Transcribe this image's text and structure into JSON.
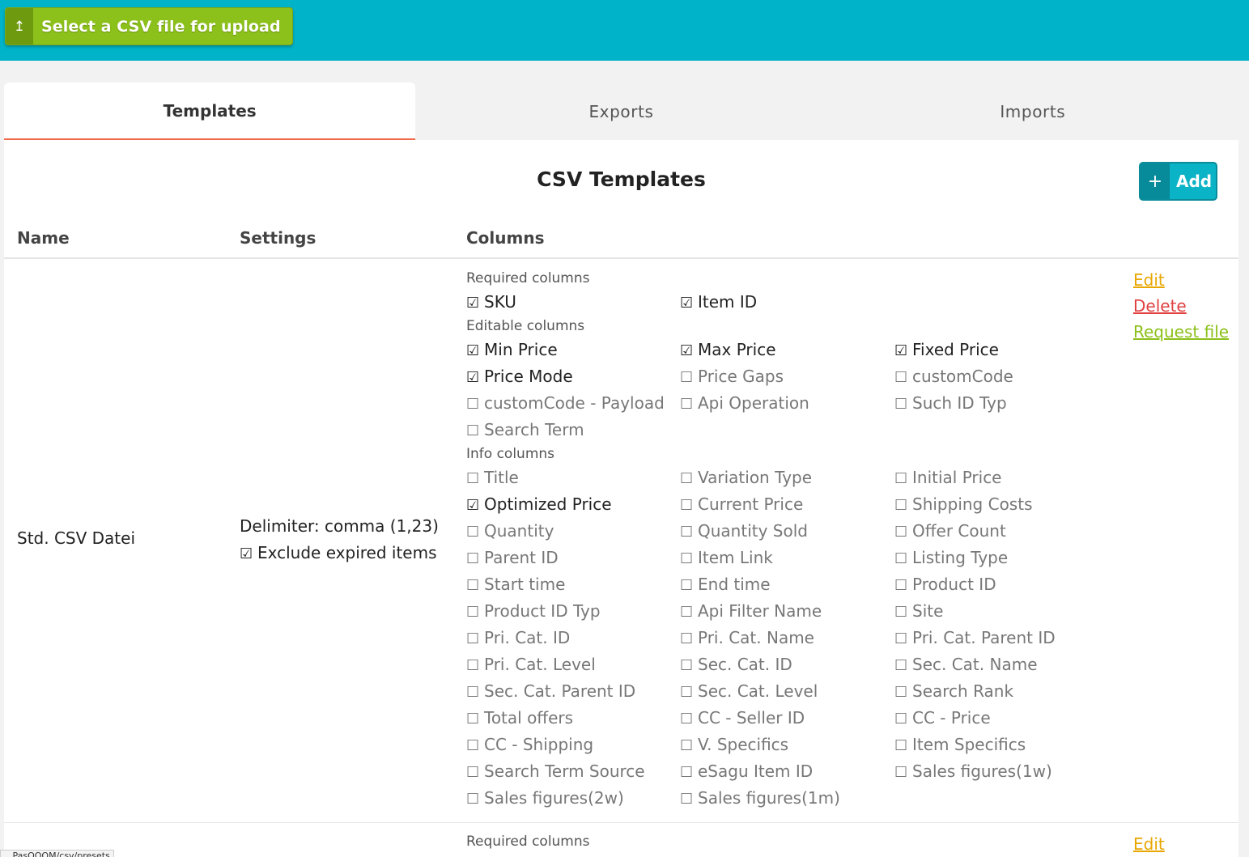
{
  "toolbar": {
    "upload_label": "Select a CSV file for upload"
  },
  "tabs": [
    {
      "label": "Templates",
      "active": true
    },
    {
      "label": "Exports",
      "active": false
    },
    {
      "label": "Imports",
      "active": false
    }
  ],
  "panel": {
    "title": "CSV Templates",
    "add_label": "Add"
  },
  "table": {
    "headers": {
      "name": "Name",
      "settings": "Settings",
      "columns": "Columns"
    },
    "group_labels": {
      "required": "Required columns",
      "editable": "Editable columns",
      "info": "Info columns"
    },
    "rows": [
      {
        "name": "Std. CSV Datei",
        "delimiter": "Delimiter: comma (1,23)",
        "exclude_expired": "Exclude expired items",
        "actions": {
          "edit": "Edit",
          "delete": "Delete",
          "request": "Request file"
        },
        "required": [
          {
            "label": "SKU",
            "checked": true
          },
          {
            "label": "Item ID",
            "checked": true
          }
        ],
        "editable": [
          {
            "label": "Min Price",
            "checked": true
          },
          {
            "label": "Max Price",
            "checked": true
          },
          {
            "label": "Fixed Price",
            "checked": true
          },
          {
            "label": "Price Mode",
            "checked": true
          },
          {
            "label": "Price Gaps",
            "checked": false
          },
          {
            "label": "customCode",
            "checked": false
          },
          {
            "label": "customCode - Payload",
            "checked": false
          },
          {
            "label": "Api Operation",
            "checked": false
          },
          {
            "label": "Such ID Typ",
            "checked": false
          },
          {
            "label": "Search Term",
            "checked": false
          }
        ],
        "info": [
          {
            "label": "Title",
            "checked": false
          },
          {
            "label": "Variation Type",
            "checked": false
          },
          {
            "label": "Initial Price",
            "checked": false
          },
          {
            "label": "Optimized Price",
            "checked": true
          },
          {
            "label": "Current Price",
            "checked": false
          },
          {
            "label": "Shipping Costs",
            "checked": false
          },
          {
            "label": "Quantity",
            "checked": false
          },
          {
            "label": "Quantity Sold",
            "checked": false
          },
          {
            "label": "Offer Count",
            "checked": false
          },
          {
            "label": "Parent ID",
            "checked": false
          },
          {
            "label": "Item Link",
            "checked": false
          },
          {
            "label": "Listing Type",
            "checked": false
          },
          {
            "label": "Start time",
            "checked": false
          },
          {
            "label": "End time",
            "checked": false
          },
          {
            "label": "Product ID",
            "checked": false
          },
          {
            "label": "Product ID Typ",
            "checked": false
          },
          {
            "label": "Api Filter Name",
            "checked": false
          },
          {
            "label": "Site",
            "checked": false
          },
          {
            "label": "Pri. Cat. ID",
            "checked": false
          },
          {
            "label": "Pri. Cat. Name",
            "checked": false
          },
          {
            "label": "Pri. Cat. Parent ID",
            "checked": false
          },
          {
            "label": "Pri. Cat. Level",
            "checked": false
          },
          {
            "label": "Sec. Cat. ID",
            "checked": false
          },
          {
            "label": "Sec. Cat. Name",
            "checked": false
          },
          {
            "label": "Sec. Cat. Parent ID",
            "checked": false
          },
          {
            "label": "Sec. Cat. Level",
            "checked": false
          },
          {
            "label": "Search Rank",
            "checked": false
          },
          {
            "label": "Total offers",
            "checked": false
          },
          {
            "label": "CC - Seller ID",
            "checked": false
          },
          {
            "label": "CC - Price",
            "checked": false
          },
          {
            "label": "CC - Shipping",
            "checked": false
          },
          {
            "label": "V. Specifics",
            "checked": false
          },
          {
            "label": "Item Specifics",
            "checked": false
          },
          {
            "label": "Search Term Source",
            "checked": false
          },
          {
            "label": "eSagu Item ID",
            "checked": false
          },
          {
            "label": "Sales figures(1w)",
            "checked": false
          },
          {
            "label": "Sales figures(2w)",
            "checked": false
          },
          {
            "label": "Sales figures(1m)",
            "checked": false
          }
        ]
      },
      {
        "required_label": "Required columns",
        "actions": {
          "edit": "Edit"
        }
      }
    ]
  },
  "statusbar": {
    "url": "...PasOOOM/csv/presets"
  },
  "icons": {
    "upload": "upload-arrow-icon",
    "add": "plus-icon",
    "checked": "checkbox-checked-icon",
    "unchecked": "checkbox-unchecked-icon"
  },
  "colors": {
    "header_bg": "#00b3c8",
    "upload_btn": "#8cc01a",
    "tab_accent": "#f06a4a",
    "add_btn": "#0bb3c6",
    "edit": "#e8a600",
    "delete": "#e04040",
    "request": "#8cc01a"
  }
}
